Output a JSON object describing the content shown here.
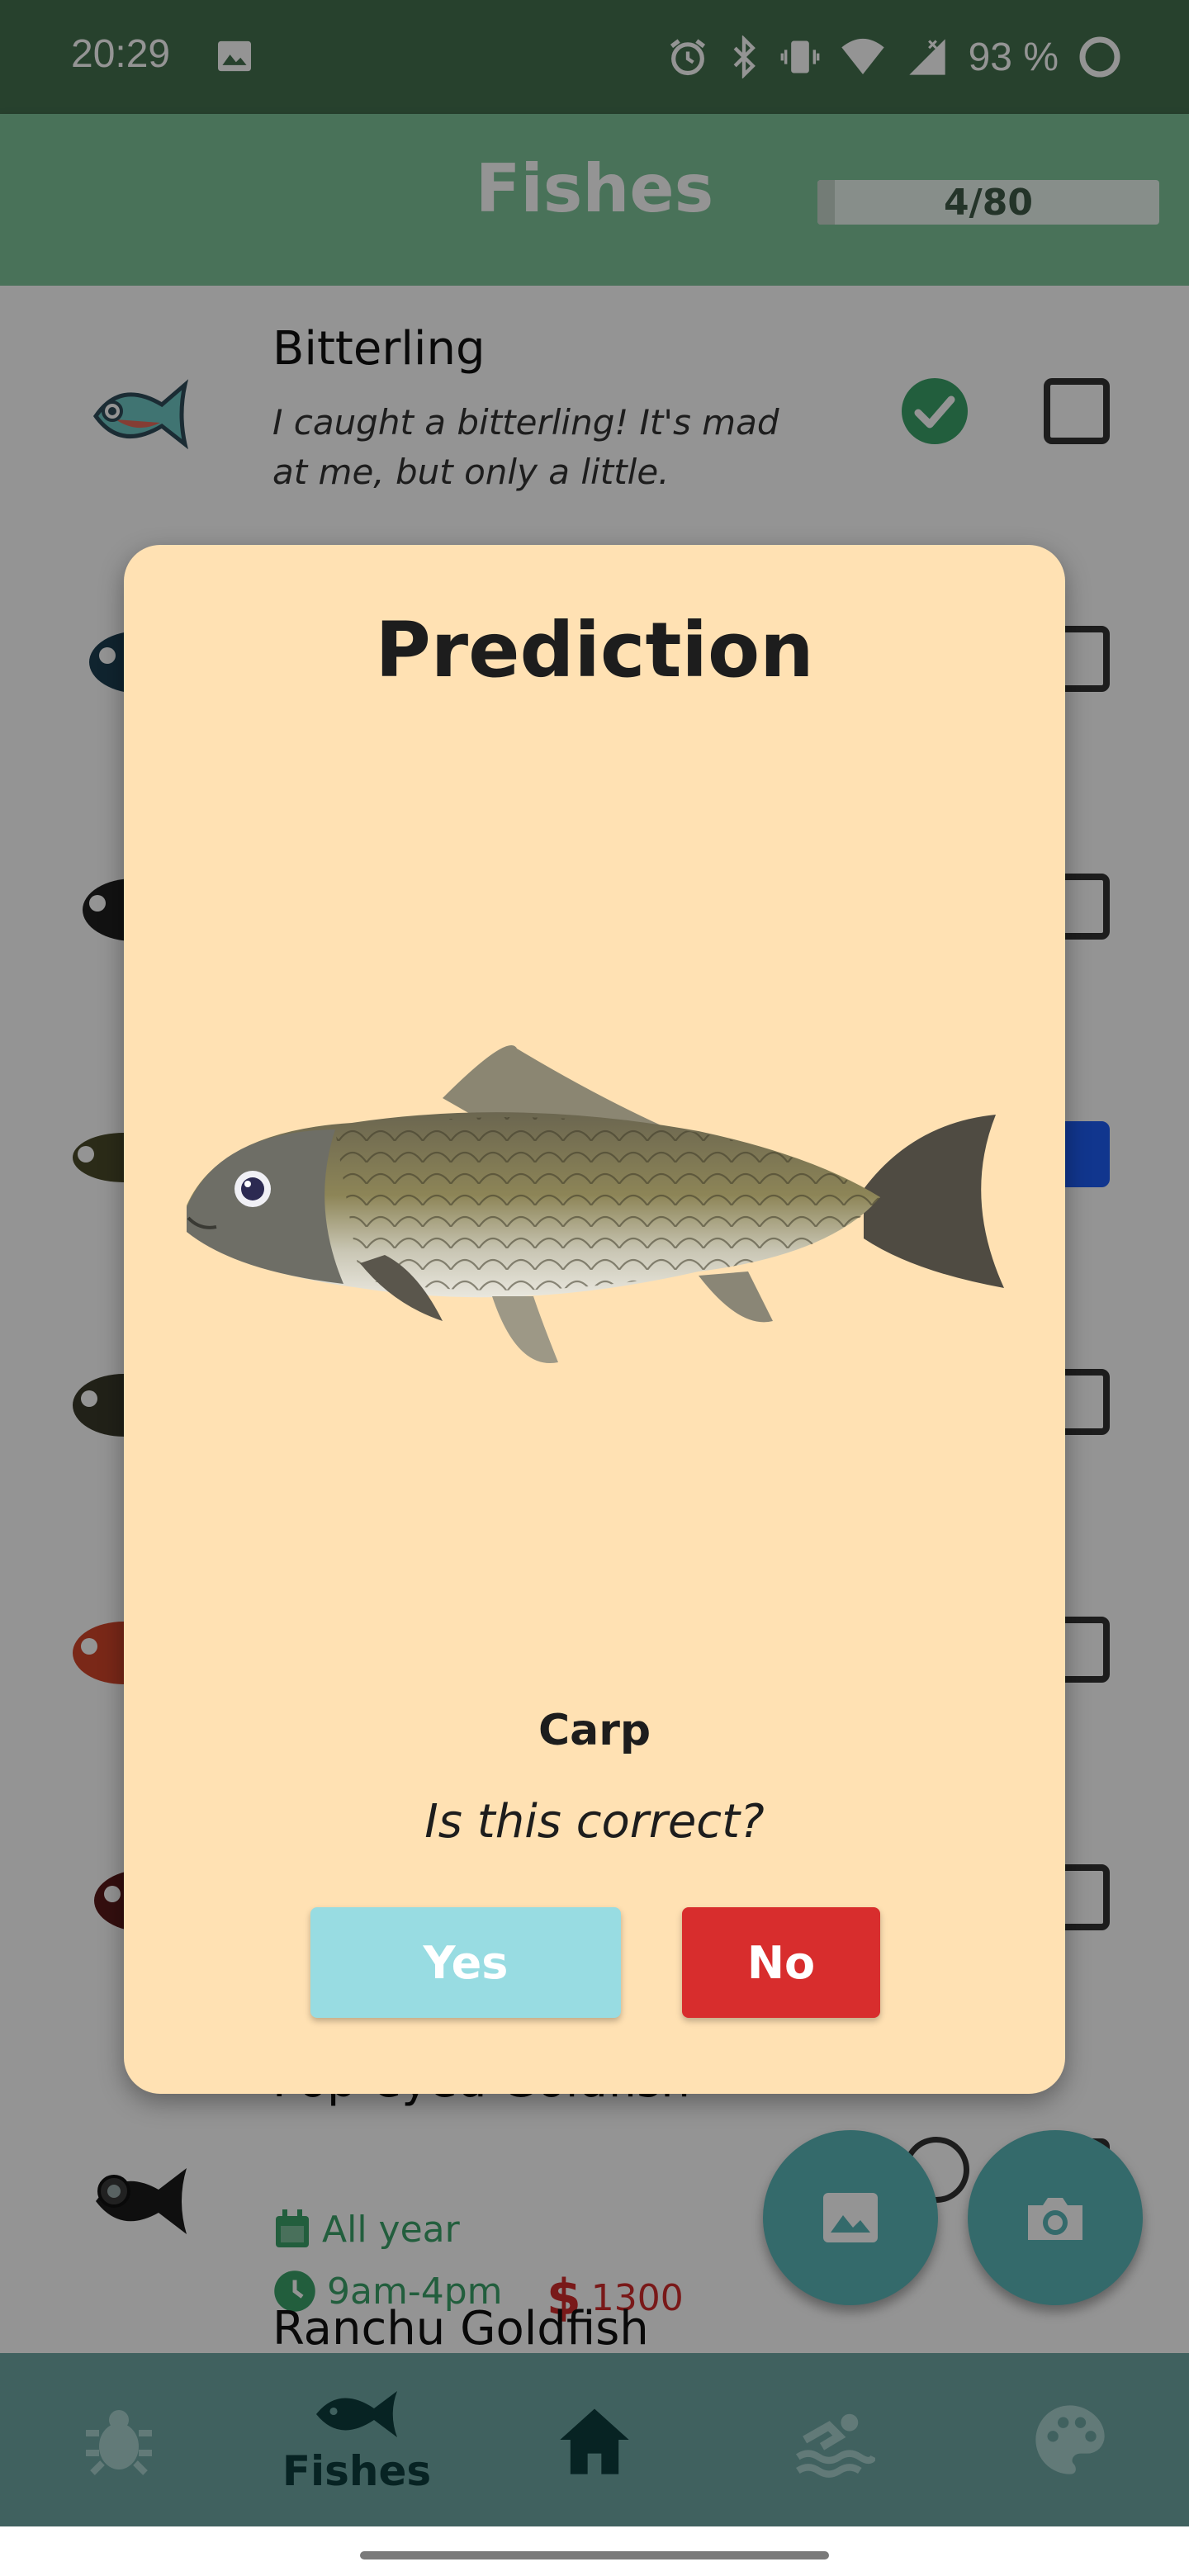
{
  "status_bar": {
    "time": "20:29",
    "battery_text": "93 %",
    "icons": [
      "image-icon",
      "alarm-icon",
      "bluetooth-icon",
      "vibrate-icon",
      "wifi-icon",
      "signal-icon",
      "battery-ring-icon"
    ]
  },
  "header": {
    "title": "Fishes",
    "progress_text": "4/80",
    "progress_fraction": 0.05
  },
  "list": {
    "rows": [
      {
        "name": "Bitterling",
        "quote": "I caught a bitterling! It's mad at me, but only a little.",
        "caught": true,
        "donated": false
      },
      {
        "name_partial": "Pop-eyed Goldfish",
        "season": "All year",
        "hours": "9am-4pm",
        "price_symbol": "$",
        "price": "1300",
        "caught": false,
        "donated": false
      },
      {
        "name": "Ranchu Goldfish"
      }
    ]
  },
  "fabs": {
    "gallery": "gallery-icon",
    "camera": "camera-icon"
  },
  "bottom_nav": {
    "items": [
      {
        "icon": "bug-icon",
        "label": ""
      },
      {
        "icon": "fish-icon",
        "label": "Fishes",
        "active": true
      },
      {
        "icon": "home-icon",
        "label": ""
      },
      {
        "icon": "swimmer-icon",
        "label": ""
      },
      {
        "icon": "palette-icon",
        "label": ""
      }
    ]
  },
  "dialog": {
    "title": "Prediction",
    "image": "carp-image",
    "fish_name": "Carp",
    "question": "Is this correct?",
    "yes_label": "Yes",
    "no_label": "No"
  },
  "colors": {
    "header": "#7fc59a",
    "status_bar": "#44704f",
    "dialog_bg": "#ffe1b3",
    "yes": "#98dce2",
    "no": "#d82d2d",
    "nav": "#6ea7a4",
    "fab": "#5bb7b9"
  }
}
